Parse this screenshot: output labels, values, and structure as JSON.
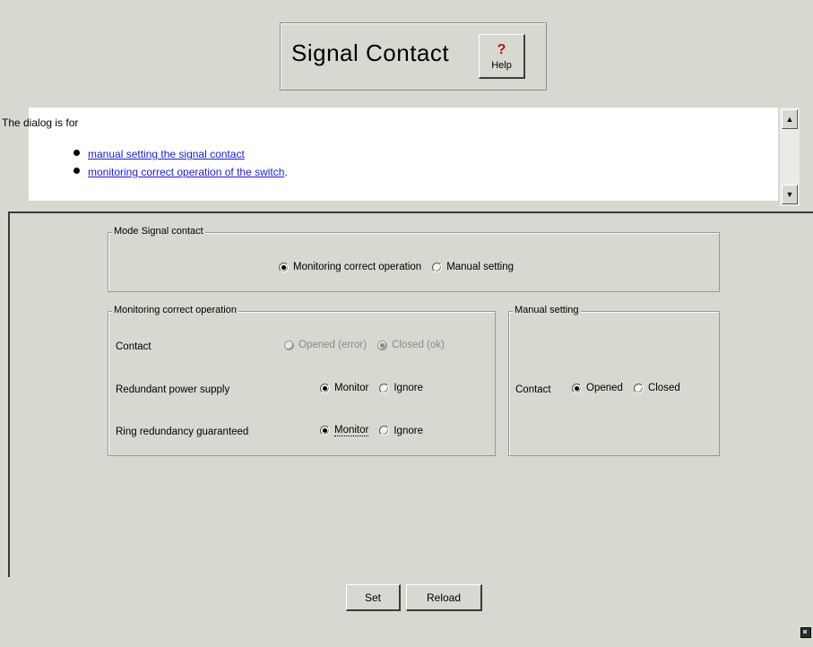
{
  "header": {
    "title": "Signal Contact",
    "help_glyph": "?",
    "help_label": "Help"
  },
  "info": {
    "intro": "The dialog is for",
    "items": [
      "manual setting the signal contact",
      "monitoring correct operation of the switch"
    ],
    "item_suffix": [
      ".",
      ""
    ]
  },
  "mode_group": {
    "legend": "Mode Signal contact",
    "options": [
      "Monitoring correct operation",
      "Manual setting"
    ],
    "selected": "Monitoring correct operation"
  },
  "monitoring_group": {
    "legend": "Monitoring correct operation",
    "rows": [
      {
        "label": "Contact",
        "options": [
          "Opened (error)",
          "Closed (ok)"
        ],
        "selected": "Closed (ok)",
        "disabled": true
      },
      {
        "label": "Redundant power supply",
        "options": [
          "Monitor",
          "Ignore"
        ],
        "selected": "Monitor",
        "disabled": false
      },
      {
        "label": "Ring redundancy guaranteed",
        "options": [
          "Monitor",
          "Ignore"
        ],
        "selected": "Monitor",
        "disabled": false
      }
    ]
  },
  "manual_group": {
    "legend": "Manual setting",
    "contact_label": "Contact",
    "options": [
      "Opened",
      "Closed"
    ],
    "selected": "Opened"
  },
  "buttons": {
    "set_label": "Set",
    "reload_label": "Reload"
  },
  "colors": {
    "background": "#d6d9d0",
    "link": "#1b1bd8",
    "help_mark": "#c01010"
  }
}
